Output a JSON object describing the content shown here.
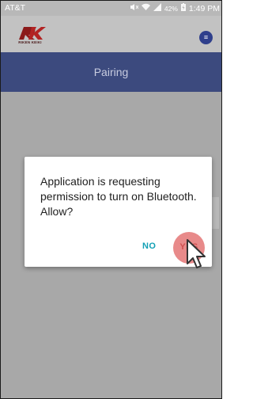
{
  "status_bar": {
    "carrier": "AT&T",
    "battery": "42%",
    "time": "1:49 PM"
  },
  "header": {
    "logo_text": "RIKEN KEIKI",
    "menu_icon": "≡"
  },
  "page_title": "Pairing",
  "dialog": {
    "message": "Application is requesting permission to turn on Bluetooth. Allow?",
    "no_label": "NO",
    "yes_label": "YES"
  },
  "colors": {
    "titlebar": "#3c4a7e",
    "menu_button": "#2f3f8c",
    "no_button": "#12a0b5",
    "yes_ripple": "#e88a8a"
  }
}
